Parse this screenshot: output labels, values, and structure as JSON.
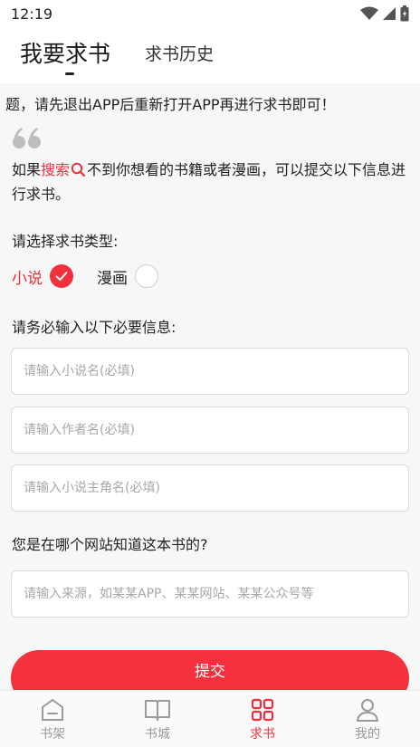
{
  "status_bar": {
    "time": "12:19",
    "icons": [
      "wifi-icon",
      "signal-icon",
      "battery-icon"
    ]
  },
  "header": {
    "tabs": [
      {
        "label": "我要求书",
        "active": true
      },
      {
        "label": "求书历史",
        "active": false
      }
    ]
  },
  "main": {
    "notice": "题，请先退出APP后重新打开APP再进行求书即可！",
    "intro_prefix": "如果",
    "intro_link": "搜索",
    "intro_suffix": "不到你想看的书籍或者漫画，可以提交以下信息进行求书。",
    "type_label": "请选择求书类型:",
    "type_options": [
      {
        "label": "小说",
        "selected": true
      },
      {
        "label": "漫画",
        "selected": false
      }
    ],
    "required_label": "请务必输入以下必要信息:",
    "fields": [
      {
        "value": "",
        "placeholder": "请输入小说名(必填)"
      },
      {
        "value": "",
        "placeholder": "请输入作者名(必填)"
      },
      {
        "value": "",
        "placeholder": "请输入小说主角名(必填)"
      }
    ],
    "source_label": "您是在哪个网站知道这本书的?",
    "source_field": {
      "value": "",
      "placeholder": "请输入来源，如某某APP、某某网站、某某公众号等"
    },
    "submit_label": "提交"
  },
  "bottom_nav": {
    "items": [
      {
        "label": "书架",
        "icon": "bookshelf-icon",
        "active": false
      },
      {
        "label": "书城",
        "icon": "book-icon",
        "active": false
      },
      {
        "label": "求书",
        "icon": "grid-icon",
        "active": true
      },
      {
        "label": "我的",
        "icon": "user-icon",
        "active": false
      }
    ]
  },
  "colors": {
    "accent": "#f0303c",
    "text": "#222222",
    "muted": "#9a9a9a",
    "background": "#f7f7f7"
  }
}
